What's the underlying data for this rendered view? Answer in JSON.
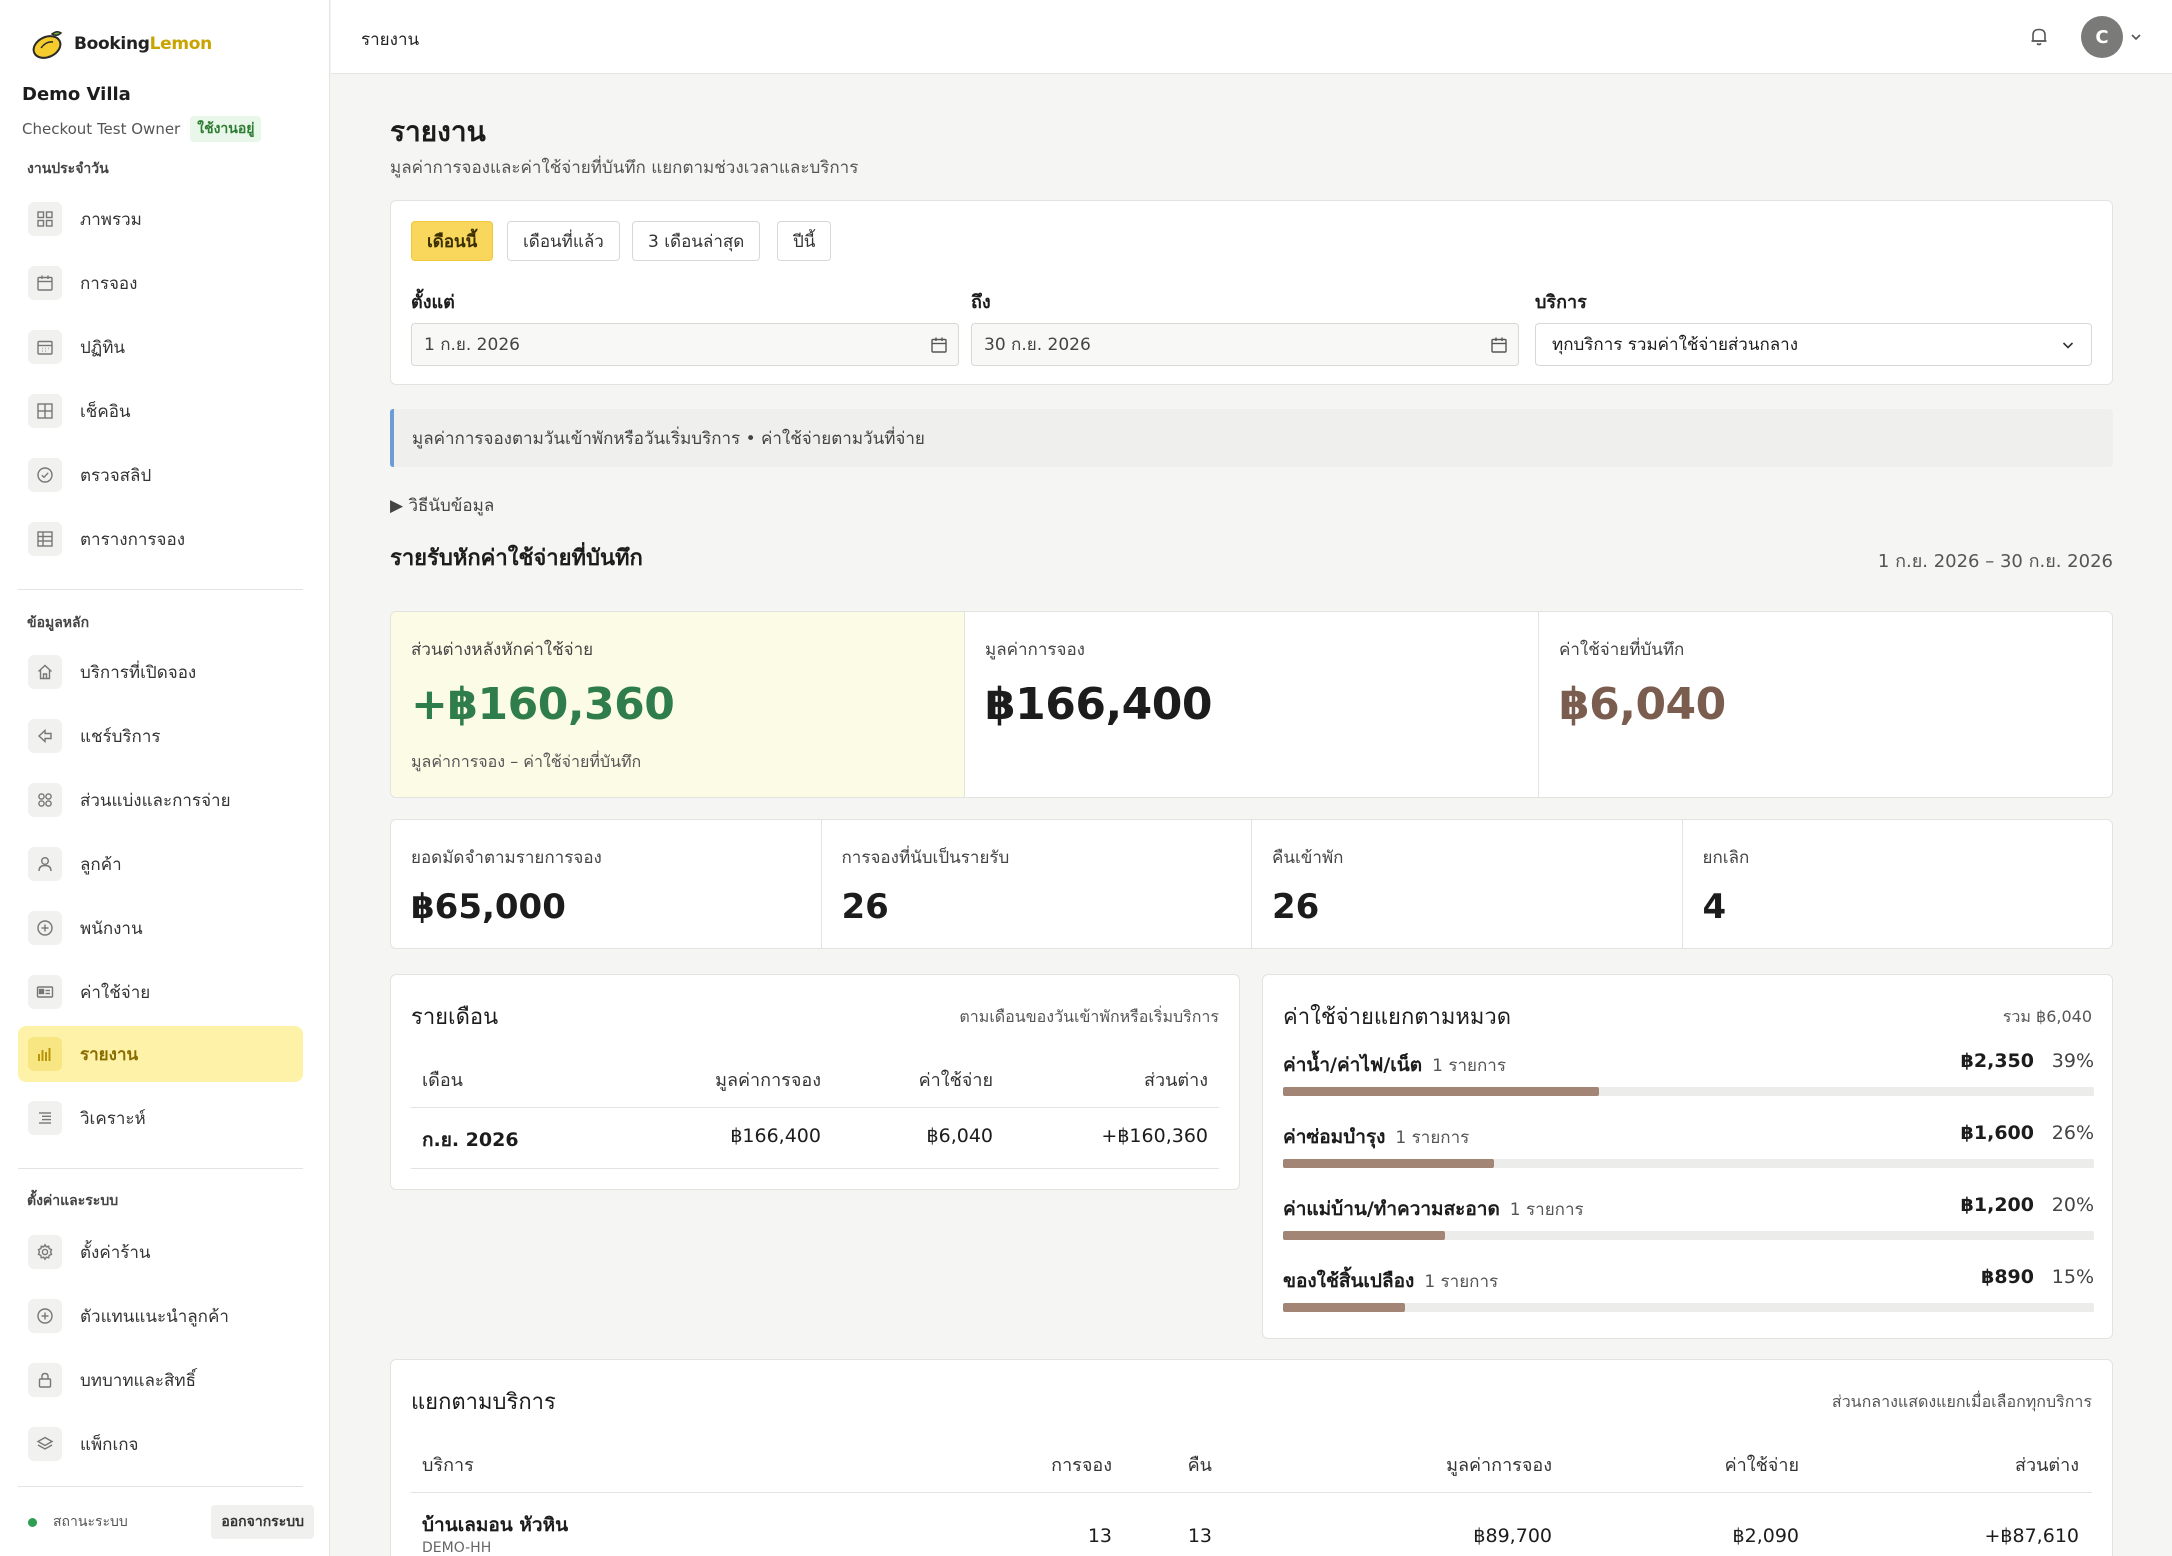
{
  "brand": {
    "name_a": "Booking",
    "name_b": "Lemon"
  },
  "sidebar": {
    "venue": "Demo Villa",
    "owner": "Checkout Test Owner",
    "owner_status": "ใช้งานอยู่",
    "section_daily": "งานประจำวัน",
    "section_master": "ข้อมูลหลัก",
    "section_settings": "ตั้งค่าและระบบ",
    "items": [
      {
        "label": "ภาพรวม",
        "icon": "grid-icon"
      },
      {
        "label": "การจอง",
        "icon": "calendar-icon"
      },
      {
        "label": "ปฏิทิน",
        "icon": "calendar-month-icon"
      },
      {
        "label": "เช็คอิน",
        "icon": "checkin-icon"
      },
      {
        "label": "ตรวจสลิป",
        "icon": "check-circle-icon"
      },
      {
        "label": "ตารางการจอง",
        "icon": "table-icon"
      },
      {
        "label": "บริการที่เปิดจอง",
        "icon": "home-icon"
      },
      {
        "label": "แชร์บริการ",
        "icon": "share-icon"
      },
      {
        "label": "ส่วนแบ่งและการจ่าย",
        "icon": "split-icon"
      },
      {
        "label": "ลูกค้า",
        "icon": "user-icon"
      },
      {
        "label": "พนักงาน",
        "icon": "plus-circle-icon"
      },
      {
        "label": "ค่าใช้จ่าย",
        "icon": "expense-icon"
      },
      {
        "label": "รายงาน",
        "icon": "bar-chart-icon"
      },
      {
        "label": "วิเคราะห์",
        "icon": "list-icon"
      },
      {
        "label": "ตั้งค่าร้าน",
        "icon": "gear-icon"
      },
      {
        "label": "ตัวแทนแนะนำลูกค้า",
        "icon": "plus-circle-icon"
      },
      {
        "label": "บทบาทและสิทธิ์",
        "icon": "lock-icon"
      },
      {
        "label": "แพ็กเกจ",
        "icon": "layers-icon"
      }
    ],
    "status": "สถานะระบบ",
    "logout": "ออกจากระบบ"
  },
  "topbar": {
    "title": "รายงาน",
    "avatar_initial": "C"
  },
  "page": {
    "title": "รายงาน",
    "subtitle": "มูลค่าการจองและค่าใช้จ่ายที่บันทึก แยกตามช่วงเวลาและบริการ"
  },
  "filters": {
    "periods": [
      "เดือนนี้",
      "เดือนที่แล้ว",
      "3 เดือนล่าสุด",
      "ปีนี้"
    ],
    "from_label": "ตั้งแต่",
    "from_value": "1 ก.ย. 2026",
    "to_label": "ถึง",
    "to_value": "30 ก.ย. 2026",
    "service_label": "บริการ",
    "service_value": "ทุกบริการ รวมค่าใช้จ่ายส่วนกลาง"
  },
  "notice": "มูลค่าการจองตามวันเข้าพักหรือวันเริ่มบริการ • ค่าใช้จ่ายตามวันที่จ่าย",
  "howto": "▶ วิธีนับข้อมูล",
  "summary": {
    "title": "รายรับหักค่าใช้จ่ายที่บันทึก",
    "date_range": "1 ก.ย. 2026 – 30 ก.ย. 2026",
    "kpis": [
      {
        "label": "ส่วนต่างหลังหักค่าใช้จ่าย",
        "value": "+฿160,360",
        "note": "มูลค่าการจอง – ค่าใช้จ่ายที่บันทึก"
      },
      {
        "label": "มูลค่าการจอง",
        "value": "฿166,400"
      },
      {
        "label": "ค่าใช้จ่ายที่บันทึก",
        "value": "฿6,040"
      }
    ],
    "stats": [
      {
        "label": "ยอดมัดจำตามรายการจอง",
        "value": "฿65,000"
      },
      {
        "label": "การจองที่นับเป็นรายรับ",
        "value": "26"
      },
      {
        "label": "คืนเข้าพัก",
        "value": "26"
      },
      {
        "label": "ยกเลิก",
        "value": "4"
      }
    ]
  },
  "monthly": {
    "title": "รายเดือน",
    "note": "ตามเดือนของวันเข้าพักหรือเริ่มบริการ",
    "columns": [
      "เดือน",
      "มูลค่าการจอง",
      "ค่าใช้จ่าย",
      "ส่วนต่าง"
    ],
    "rows": [
      [
        "ก.ย. 2026",
        "฿166,400",
        "฿6,040",
        "+฿160,360"
      ]
    ]
  },
  "categories": {
    "title": "ค่าใช้จ่ายแยกตามหมวด",
    "total": "รวม ฿6,040",
    "items": [
      {
        "name": "ค่าน้ำ/ค่าไฟ/เน็ต",
        "count": "1 รายการ",
        "amount": "฿2,350",
        "pct": "39%",
        "fraction": 0.39
      },
      {
        "name": "ค่าซ่อมบำรุง",
        "count": "1 รายการ",
        "amount": "฿1,600",
        "pct": "26%",
        "fraction": 0.26
      },
      {
        "name": "ค่าแม่บ้าน/ทำความสะอาด",
        "count": "1 รายการ",
        "amount": "฿1,200",
        "pct": "20%",
        "fraction": 0.2
      },
      {
        "name": "ของใช้สิ้นเปลือง",
        "count": "1 รายการ",
        "amount": "฿890",
        "pct": "15%",
        "fraction": 0.15
      }
    ]
  },
  "by_service": {
    "title": "แยกตามบริการ",
    "note": "ส่วนกลางแสดงแยกเมื่อเลือกทุกบริการ",
    "columns": [
      "บริการ",
      "การจอง",
      "คืน",
      "มูลค่าการจอง",
      "ค่าใช้จ่าย",
      "ส่วนต่าง"
    ],
    "rows": [
      {
        "name": "บ้านเลมอน หัวหิน",
        "code": "DEMO-HH",
        "bookings": "13",
        "nights": "13",
        "value": "฿89,700",
        "expense": "฿2,090",
        "diff": "+฿87,610"
      }
    ]
  },
  "colors": {
    "accent": "#f8d75c",
    "active_nav": "#fdf2a8",
    "positive": "#2f7d4a",
    "expense": "#7a5d4e",
    "bar": "#a38576"
  }
}
